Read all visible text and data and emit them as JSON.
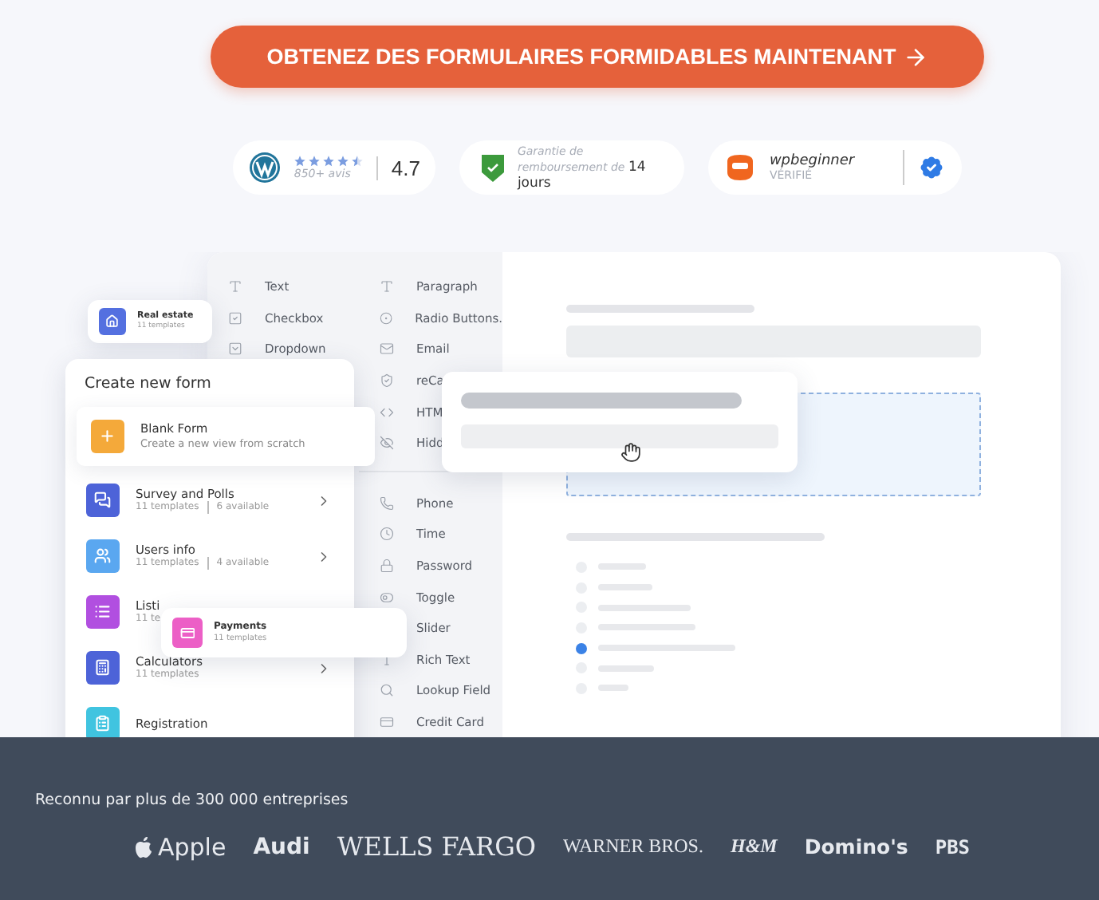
{
  "cta": {
    "label": "OBTENEZ DES FORMULAIRES FORMIDABLES MAINTENANT"
  },
  "badges": {
    "rating": {
      "stars": 4.5,
      "reviews": "850+ avis",
      "score": "4.7"
    },
    "guarantee": {
      "text": "Garantie de remboursement de **14 jours**"
    },
    "partner": {
      "name": "wpbeginner",
      "status": "VÉRIFIÉ"
    }
  },
  "builder": {
    "fields_left": [
      {
        "kind": "text",
        "label": "Text"
      },
      {
        "kind": "checkbox",
        "label": "Checkbox"
      },
      {
        "kind": "dropdown",
        "label": "Dropdown"
      }
    ],
    "fields_right": [
      {
        "kind": "text",
        "label": "Paragraph"
      },
      {
        "kind": "radio",
        "label": "Radio Buttons."
      },
      {
        "kind": "email",
        "label": "Email"
      },
      {
        "kind": "captcha",
        "label": "reCa"
      },
      {
        "kind": "html",
        "label": "HTM"
      },
      {
        "kind": "hidden",
        "label": "Hidd"
      }
    ],
    "fields_more": [
      {
        "kind": "phone",
        "label": "Phone"
      },
      {
        "kind": "time",
        "label": "Time"
      },
      {
        "kind": "password",
        "label": "Password"
      },
      {
        "kind": "toggle",
        "label": "Toggle"
      },
      {
        "kind": "slider",
        "label": "Slider"
      },
      {
        "kind": "richtext",
        "label": "Rich Text"
      },
      {
        "kind": "lookup",
        "label": "Lookup Field"
      },
      {
        "kind": "card",
        "label": "Credit Card"
      }
    ],
    "radio_options": [
      {
        "selected": false
      },
      {
        "selected": false
      },
      {
        "selected": false
      },
      {
        "selected": false
      },
      {
        "selected": true
      },
      {
        "selected": false
      },
      {
        "selected": false
      }
    ]
  },
  "real_estate": {
    "kind": "house",
    "color": "#5470e0",
    "title": "Real estate",
    "subtitle": "11 templates"
  },
  "create_form": {
    "title": "Create new form",
    "blank": {
      "kind": "plus",
      "color": "#f4a93a",
      "title": "Blank Form",
      "subtitle": "Create a new view from scratch"
    },
    "templates": [
      {
        "kind": "chat",
        "color": "#4d63d8",
        "title": "Survey and Polls",
        "templates": "11 templates",
        "available": "6 available",
        "chevron": true
      },
      {
        "kind": "users",
        "color": "#5aa7f0",
        "title": "Users info",
        "templates": "11 templates",
        "available": "4 available",
        "chevron": true
      },
      {
        "kind": "list",
        "color": "#b14fe0",
        "title": "Listi",
        "templates": "11 te"
      },
      {
        "kind": "calculator",
        "color": "#4d63d8",
        "title": "Calculators",
        "templates": "11 templates",
        "chevron": true
      },
      {
        "kind": "clipboard",
        "color": "#40c4e0",
        "title": "Registration"
      }
    ]
  },
  "payments": {
    "kind": "card",
    "color": "#ec5fc6",
    "title": "Payments",
    "subtitle": "11 templates"
  },
  "footer": {
    "caption": "Reconnu par plus de 300 000 entreprises",
    "logos": [
      {
        "kind": "apple",
        "label": "Apple"
      },
      {
        "kind": "audi",
        "label": "Audi"
      },
      {
        "kind": "wells",
        "label": "WELLS FARGO"
      },
      {
        "kind": "warner",
        "label": "WARNER BROS."
      },
      {
        "kind": "hm",
        "label": "H&M"
      },
      {
        "kind": "dominos",
        "label": "Domino's"
      },
      {
        "kind": "pbs",
        "label": "PBS"
      }
    ]
  }
}
